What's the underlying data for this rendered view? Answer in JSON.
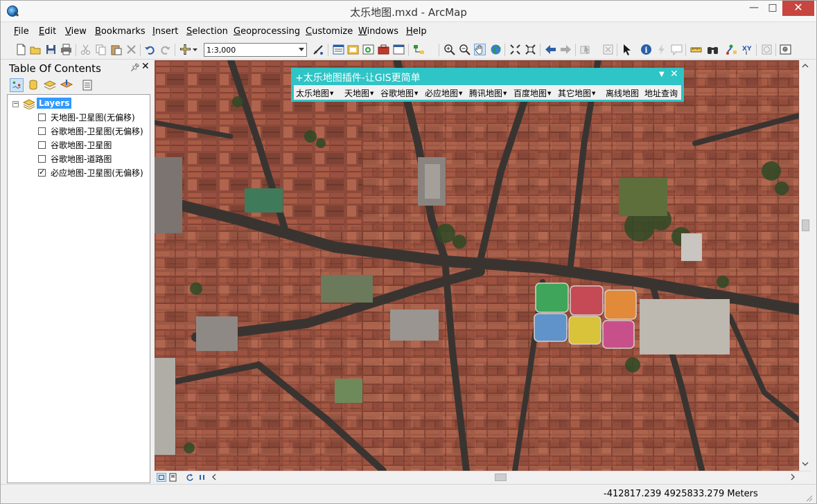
{
  "window": {
    "title": "太乐地图.mxd - ArcMap",
    "min_label": "—",
    "max_label": "□",
    "close_label": "✕"
  },
  "menus": [
    "File",
    "Edit",
    "View",
    "Bookmarks",
    "Insert",
    "Selection",
    "Geoprocessing",
    "Customize",
    "Windows",
    "Help"
  ],
  "menu_hotkeys": [
    "F",
    "E",
    "V",
    "B",
    "I",
    "S",
    "G",
    "C",
    "W",
    "H"
  ],
  "toolbar": {
    "scale_value": "1:3,000"
  },
  "toc": {
    "title": "Table Of Contents",
    "pin_icon": "pin-icon",
    "close_label": "✕",
    "root_label": "Layers",
    "layers": [
      {
        "name": "天地图-卫星图(无偏移)",
        "checked": false
      },
      {
        "name": "谷歌地图-卫星图(无偏移)",
        "checked": false
      },
      {
        "name": "谷歌地图-卫星图",
        "checked": false
      },
      {
        "name": "谷歌地图-道路图",
        "checked": false
      },
      {
        "name": "必应地图-卫星图(无偏移)",
        "checked": true
      }
    ]
  },
  "plugin": {
    "title": "+太乐地图插件-让GIS更简单",
    "menus": [
      "太乐地图",
      "天地图",
      "谷歌地图",
      "必应地图",
      "腾讯地图",
      "百度地图",
      "其它地图"
    ],
    "links": [
      "离线地图",
      "地址查询"
    ]
  },
  "status": {
    "coordinates": "-412817.239  4925833.279 Meters"
  },
  "colors": {
    "plugin_accent": "#2fc4c6",
    "selection": "#3399ff",
    "close_button": "#c7463f"
  }
}
